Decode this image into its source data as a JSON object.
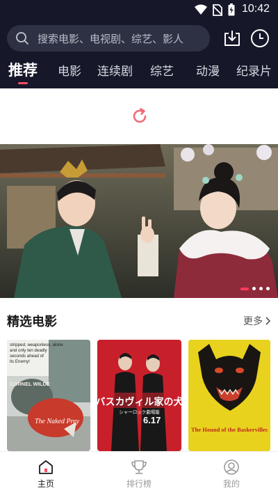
{
  "status_bar": {
    "time": "10:42"
  },
  "search": {
    "placeholder": "搜索电影、电视剧、综艺、影人"
  },
  "tabs": [
    {
      "label": "推荐",
      "active": true
    },
    {
      "label": "电影"
    },
    {
      "label": "连续剧"
    },
    {
      "label": "综艺"
    },
    {
      "label": "动漫"
    },
    {
      "label": "纪录片"
    }
  ],
  "banner": {
    "slide_index": 1,
    "slide_count": 4
  },
  "section": {
    "title": "精选电影",
    "more_label": "更多"
  },
  "posters": [
    {
      "title": "The Naked Prey",
      "lines": [
        "stripped, weaponless, alone",
        "and only ten deadly",
        "seconds ahead of",
        "its Enemy!"
      ],
      "name": "CORNEL WILDE"
    },
    {
      "title": "バスカヴィル家の犬",
      "subtitle": "シャーロック劇場版",
      "date": "6.17"
    },
    {
      "title": "The Hound of the Baskervilles"
    }
  ],
  "bottom_nav": [
    {
      "label": "主页",
      "active": true
    },
    {
      "label": "排行榜"
    },
    {
      "label": "我的"
    }
  ],
  "colors": {
    "header_bg": "#16182a",
    "accent": "#ff4d63",
    "search_bg": "#2d3143"
  }
}
